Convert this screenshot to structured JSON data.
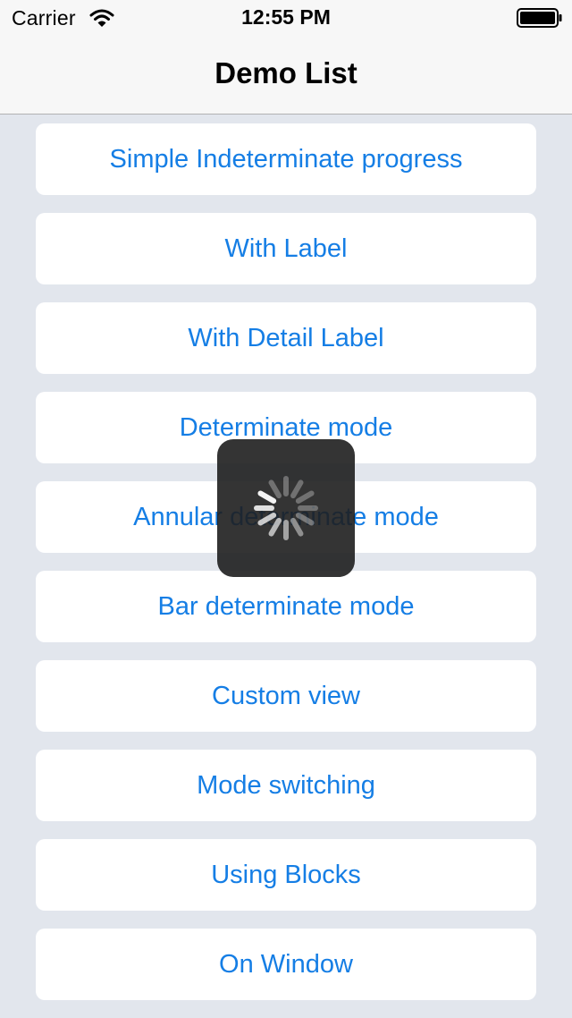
{
  "status_bar": {
    "carrier": "Carrier",
    "time": "12:55 PM",
    "wifi_icon": "wifi-icon",
    "battery_icon": "battery-icon"
  },
  "nav": {
    "title": "Demo List"
  },
  "list": {
    "items": [
      {
        "label": "Simple Indeterminate progress"
      },
      {
        "label": "With Label"
      },
      {
        "label": "With Detail Label"
      },
      {
        "label": "Determinate mode"
      },
      {
        "label": "Annular determinate mode"
      },
      {
        "label": "Bar determinate mode"
      },
      {
        "label": "Custom view"
      },
      {
        "label": "Mode switching"
      },
      {
        "label": "Using Blocks"
      },
      {
        "label": "On Window"
      }
    ]
  },
  "hud": {
    "icon": "activity-spinner-icon"
  },
  "colors": {
    "background": "#e2e6ed",
    "nav_background": "#f7f7f7",
    "button_background": "#ffffff",
    "accent_text": "#157ee5",
    "hud_background": "#1e1e1e"
  }
}
